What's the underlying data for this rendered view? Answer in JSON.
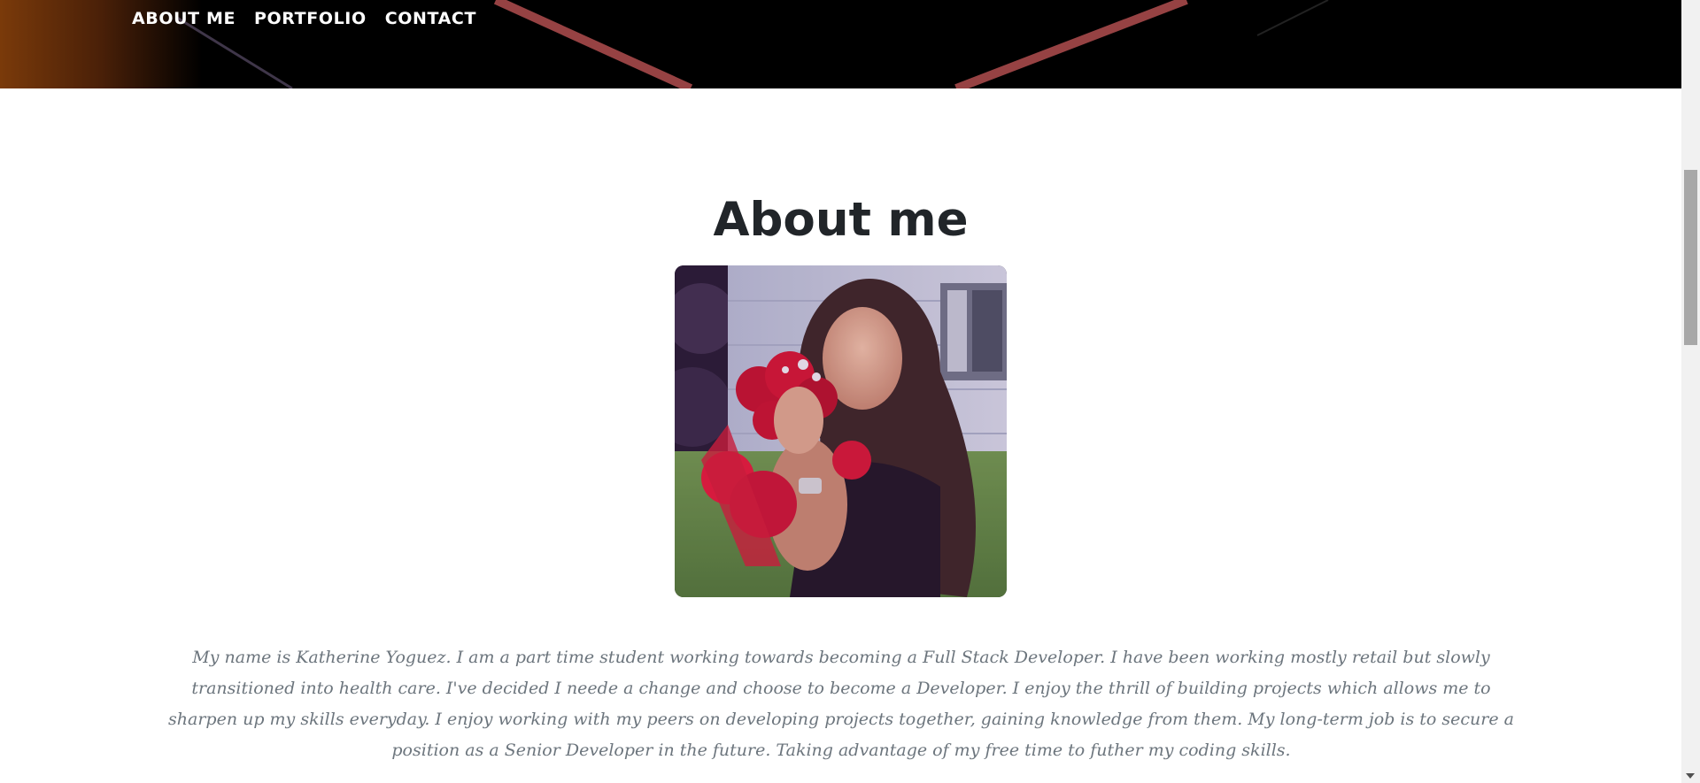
{
  "nav": {
    "items": [
      {
        "label": "ABOUT ME"
      },
      {
        "label": "PORTFOLIO"
      },
      {
        "label": "CONTACT"
      }
    ]
  },
  "about": {
    "title": "About me",
    "bio": "My name is Katherine Yoguez. I am a part time student working towards becoming a Full Stack Developer. I have been working mostly retail but slowly transitioned into health care. I've decided I neede a change and choose to become a Developer. I enjoy the thrill of building projects which allows me to sharpen up my skills everyday. I enjoy working with my peers on developing projects together, gaining knowledge from them. My long-term job is to secure a position as a Senior Developer in the future. Taking advantage of my free time to futher my coding skills."
  },
  "colors": {
    "heading": "#212529",
    "body_text": "#6c757d",
    "nav_text": "#ffffff",
    "header_bg": "#000000"
  },
  "icons": {
    "scroll_down": "chevron-down-icon"
  }
}
